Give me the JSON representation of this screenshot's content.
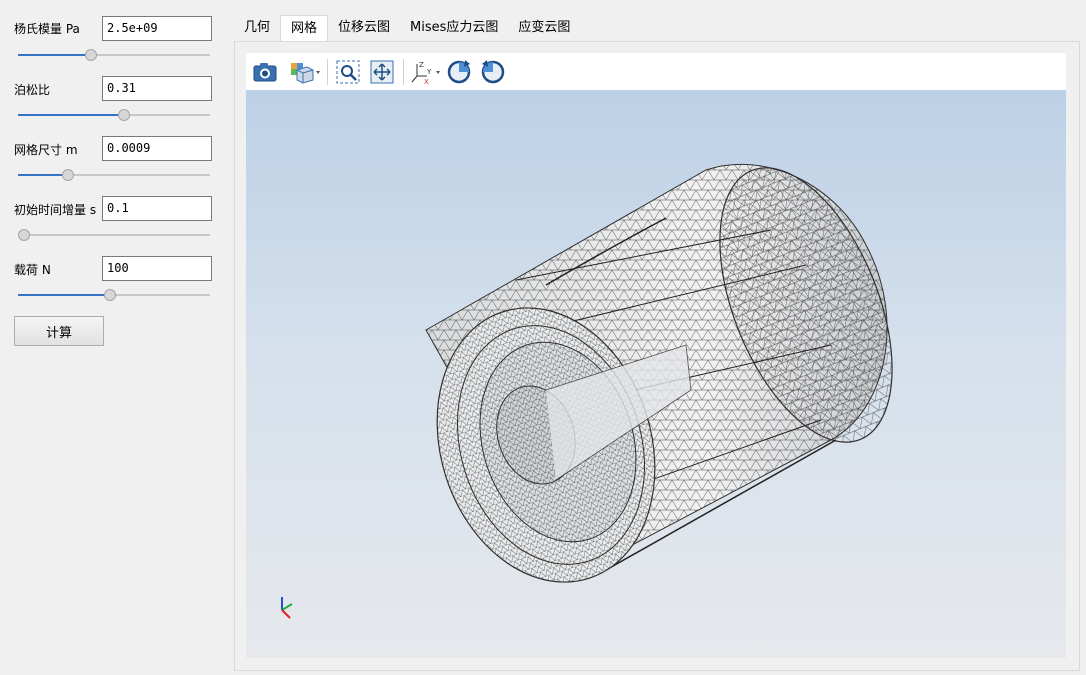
{
  "params": [
    {
      "label": "杨氏模量 Pa",
      "value": "2.5e+09",
      "slider": 0.38
    },
    {
      "label": "泊松比",
      "value": "0.31",
      "slider": 0.55
    },
    {
      "label": "网格尺寸 m",
      "value": "0.0009",
      "slider": 0.26
    },
    {
      "label": "初始时间增量 s",
      "value": "0.1",
      "slider": 0.0
    },
    {
      "label": "载荷 N",
      "value": "100",
      "slider": 0.48
    }
  ],
  "calculate_label": "计算",
  "tabs": [
    {
      "label": "几何",
      "active": false
    },
    {
      "label": "网格",
      "active": true
    },
    {
      "label": "位移云图",
      "active": false
    },
    {
      "label": "Mises应力云图",
      "active": false
    },
    {
      "label": "应变云图",
      "active": false
    }
  ],
  "toolbar": [
    {
      "name": "camera-screenshot-icon"
    },
    {
      "name": "display-mode-icon"
    },
    {
      "name": "zoom-box-icon"
    },
    {
      "name": "fit-all-icon"
    },
    {
      "name": "view-orientation-icon"
    },
    {
      "name": "rotate-clockwise-icon"
    },
    {
      "name": "rotate-counterclockwise-icon"
    }
  ],
  "axis_labels": {
    "x": "X",
    "y": "Y",
    "z": "Z"
  },
  "colors": {
    "accent": "#3873c9",
    "mesh_line": "#2f2f2f",
    "viewport_top": "#bcd0e6",
    "viewport_bottom": "#e6e8ec"
  }
}
